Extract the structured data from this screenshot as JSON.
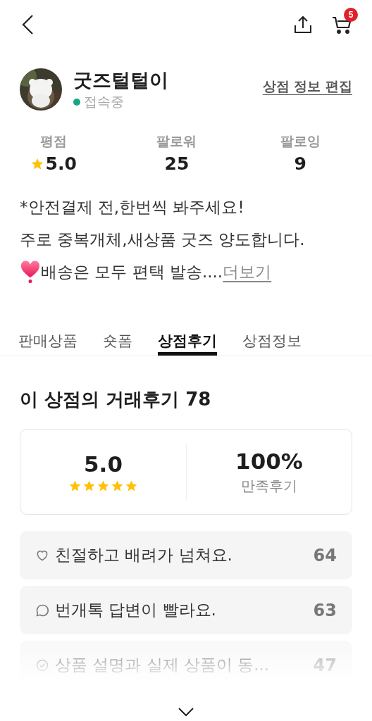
{
  "header": {
    "cart_count": "5"
  },
  "shop": {
    "name": "굿즈털털이",
    "online": true,
    "status": "접속중",
    "edit_link": "상점 정보 편집"
  },
  "stats": [
    {
      "label": "평점",
      "value": "5.0",
      "kind": "rating"
    },
    {
      "label": "팔로워",
      "value": "25",
      "kind": "plain"
    },
    {
      "label": "팔로잉",
      "value": "9",
      "kind": "plain"
    }
  ],
  "bio": {
    "lines": [
      "*안전결제 전,한번씩 봐주세요!",
      "주로 중복개체,새상품 굿즈 양도합니다."
    ],
    "last_line": "배송은 모두 편택 발송....",
    "more_link": "더보기"
  },
  "tabs": [
    {
      "label": "판매상품",
      "selected": false
    },
    {
      "label": "숏폼",
      "selected": false
    },
    {
      "label": "상점후기",
      "selected": true
    },
    {
      "label": "상점정보",
      "selected": false
    }
  ],
  "reviews": {
    "title": "이 상점의 거래후기 78",
    "score": "5.0",
    "stars": 5,
    "satisfaction": "100%",
    "satisfaction_label": "만족후기",
    "items": [
      {
        "kind": "heart",
        "text": "친절하고 배려가 넘쳐요.",
        "count": "64"
      },
      {
        "kind": "chat",
        "text": "번개톡 답변이 빨라요.",
        "count": "63"
      },
      {
        "kind": "check",
        "text": "상품 설명과 실제 상품이 동...",
        "count": "47"
      }
    ]
  }
}
